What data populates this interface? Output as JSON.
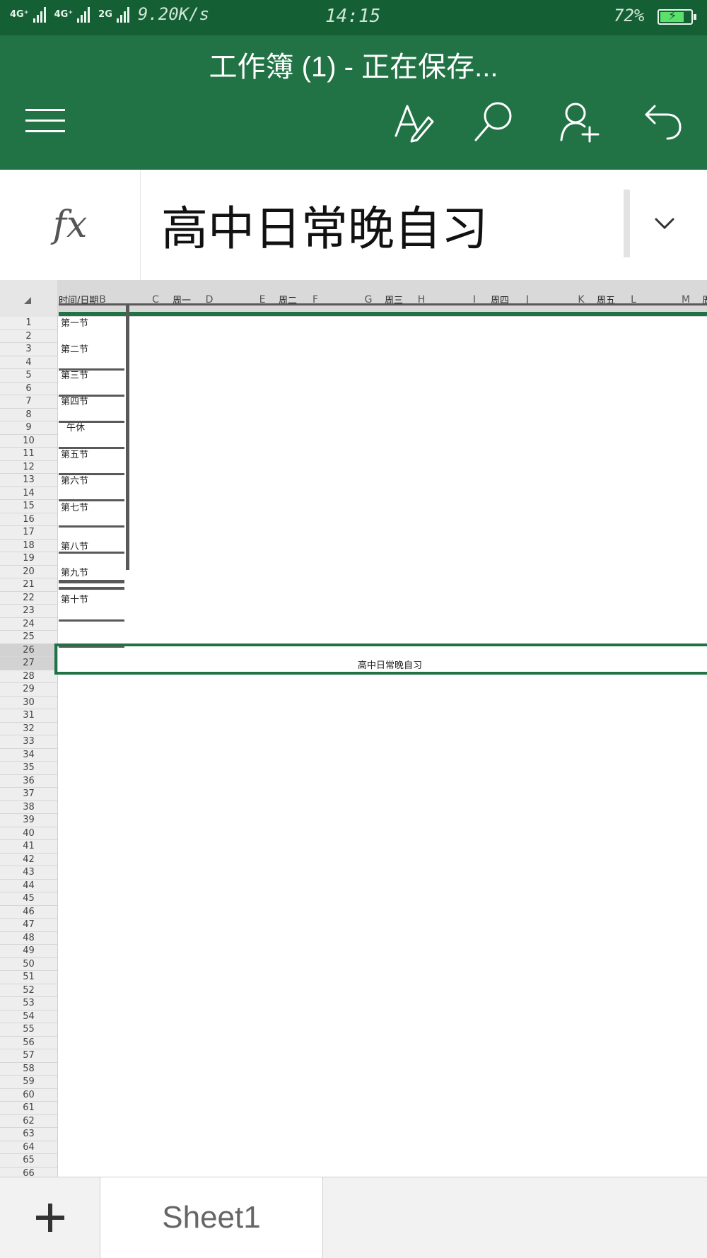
{
  "status_bar": {
    "net1": "4G⁺",
    "net2": "4G⁺",
    "net3": "2G",
    "speed": "9.20K/s",
    "time": "14:15",
    "battery": "72%"
  },
  "app_bar": {
    "title": "工作簿 (1) - 正在保存...",
    "icons": [
      "hamburger-menu-icon",
      "edit-pen-icon",
      "search-icon",
      "share-person-add-icon",
      "undo-icon"
    ]
  },
  "formula_bar": {
    "fx_label": "fx",
    "value": "高中日常晚自习"
  },
  "sheet": {
    "columns": [
      "B",
      "C",
      "D",
      "E",
      "F",
      "G",
      "H",
      "I",
      "J",
      "K",
      "L",
      "M"
    ],
    "header_row": {
      "time_date": "时间/日期",
      "days": [
        "周一",
        "周二",
        "周三",
        "周四",
        "周五",
        "周"
      ]
    },
    "periods": [
      "第一节",
      "第二节",
      "第三节",
      "第四节",
      "午休",
      "第五节",
      "第六节",
      "第七节",
      "第八节",
      "第九节",
      "第十节"
    ],
    "merged_title": "高中日常晚自习",
    "selected_rows": [
      "26",
      "27"
    ]
  },
  "tab_bar": {
    "add_label": "+",
    "sheet_name": "Sheet1"
  },
  "colors": {
    "excel_green": "#217346",
    "statusbar_green": "#155f35",
    "border_dark": "#595959"
  }
}
